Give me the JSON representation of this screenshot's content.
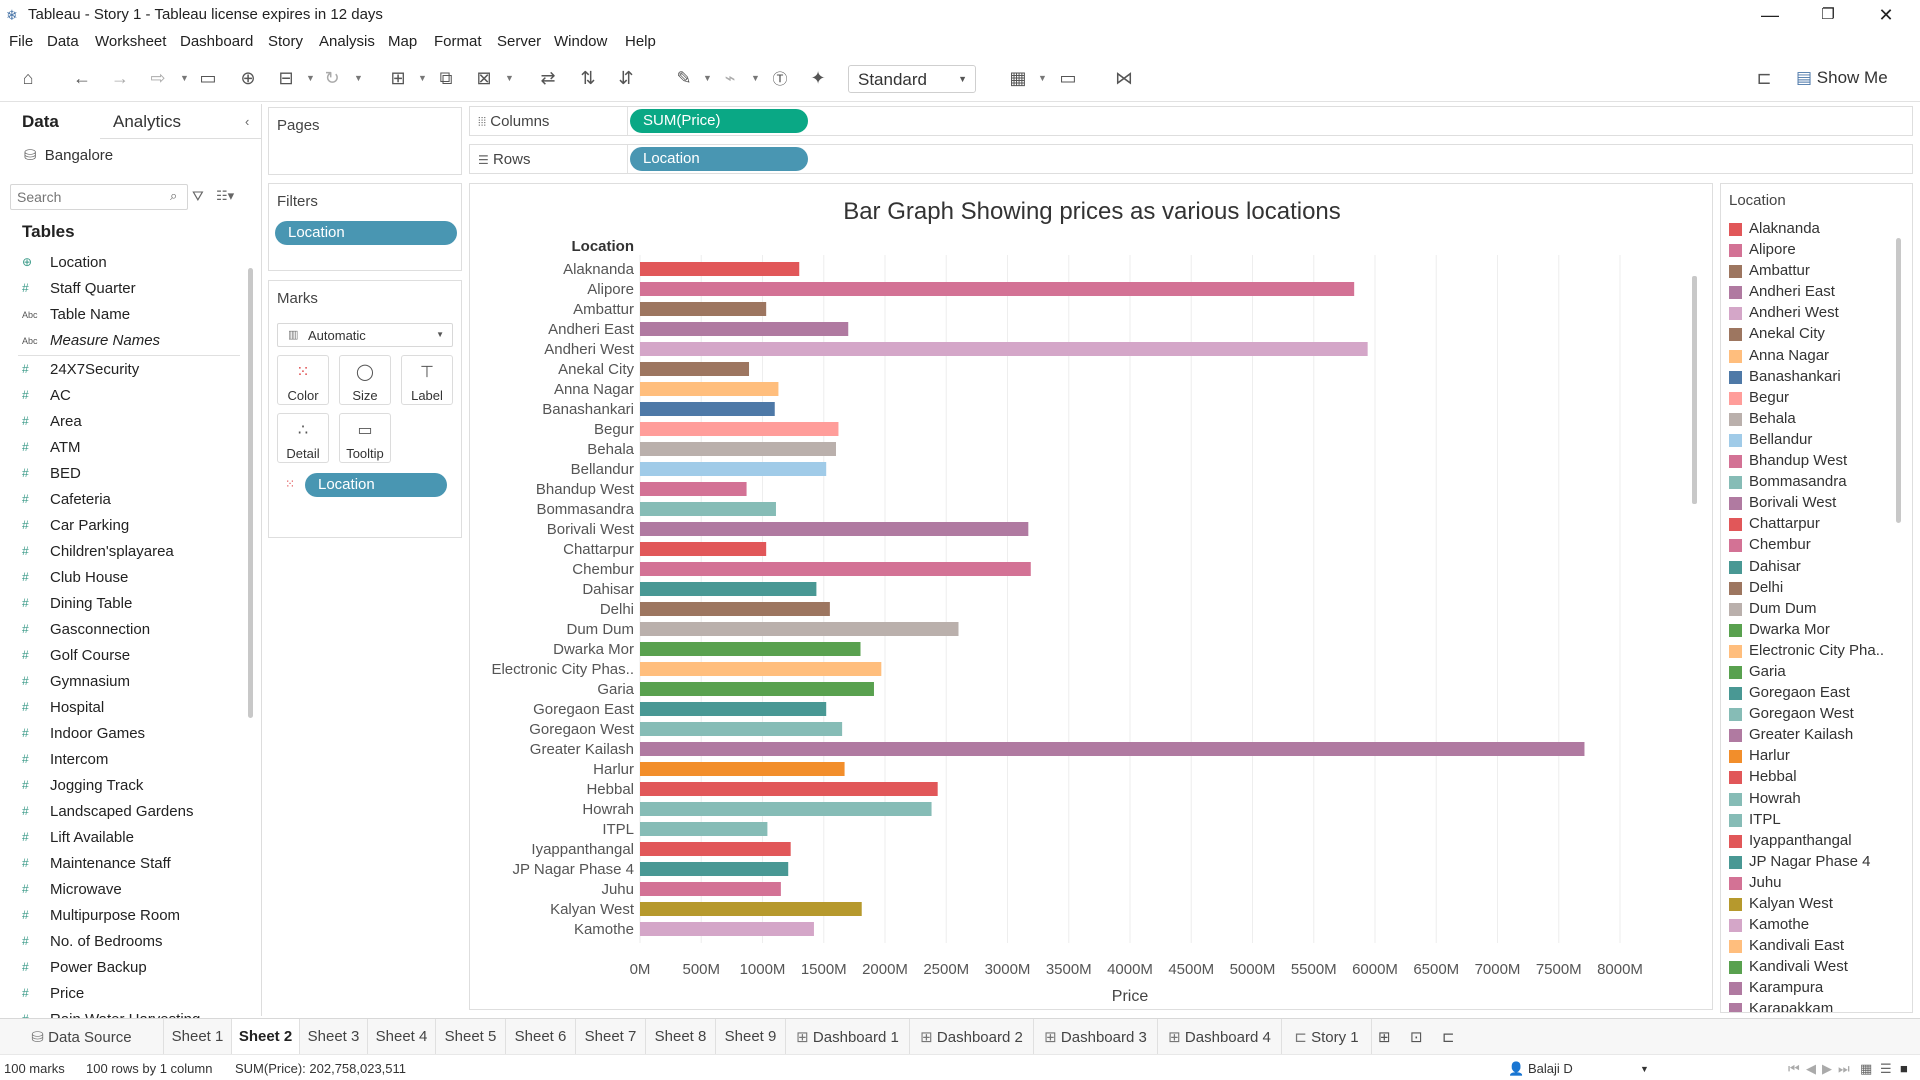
{
  "window": {
    "title": "Tableau - Story 1 - Tableau license expires in 12 days"
  },
  "menu": [
    "File",
    "Data",
    "Worksheet",
    "Dashboard",
    "Story",
    "Analysis",
    "Map",
    "Format",
    "Server",
    "Window",
    "Help"
  ],
  "toolbar": {
    "fit_value": "Standard",
    "show_me_label": "Show Me"
  },
  "data_pane": {
    "tab_data": "Data",
    "tab_analytics": "Analytics",
    "datasource": "Bangalore",
    "search_placeholder": "Search",
    "tables_heading": "Tables",
    "fields_top": [
      {
        "name": "Location",
        "type": "geo"
      },
      {
        "name": "Staff Quarter",
        "type": "num"
      },
      {
        "name": "Table Name",
        "type": "abc"
      },
      {
        "name": "Measure Names",
        "type": "abc",
        "italic": true
      }
    ],
    "fields_measures": [
      "24X7Security",
      "AC",
      "Area",
      "ATM",
      "BED",
      "Cafeteria",
      "Car Parking",
      "Children'splayarea",
      "Club House",
      "Dining Table",
      "Gasconnection",
      "Golf Course",
      "Gymnasium",
      "Hospital",
      "Indoor Games",
      "Intercom",
      "Jogging Track",
      "Landscaped Gardens",
      "Lift Available",
      "Maintenance Staff",
      "Microwave",
      "Multipurpose Room",
      "No. of Bedrooms",
      "Power Backup",
      "Price",
      "Rain Water Harvesting"
    ]
  },
  "shelves": {
    "pages_label": "Pages",
    "filters_label": "Filters",
    "filter_pill": "Location",
    "marks_label": "Marks",
    "mark_type": "Automatic",
    "mark_buttons": [
      "Color",
      "Size",
      "Label",
      "Detail",
      "Tooltip"
    ],
    "marks_pill": "Location",
    "columns_label": "Columns",
    "columns_pill": "SUM(Price)",
    "rows_label": "Rows",
    "rows_pill": "Location"
  },
  "chart_data": {
    "type": "bar",
    "orientation": "horizontal",
    "title": "Bar Graph Showing prices as various locations",
    "row_header": "Location",
    "xlabel": "Price",
    "xlim": [
      0,
      8000
    ],
    "x_unit": "M",
    "x_ticks": [
      "0M",
      "500M",
      "1000M",
      "1500M",
      "2000M",
      "2500M",
      "3000M",
      "3500M",
      "4000M",
      "4500M",
      "5000M",
      "5500M",
      "6000M",
      "6500M",
      "7000M",
      "7500M",
      "8000M"
    ],
    "grid": true,
    "categories": [
      "Alaknanda",
      "Alipore",
      "Ambattur",
      "Andheri East",
      "Andheri West",
      "Anekal City",
      "Anna Nagar",
      "Banashankari",
      "Begur",
      "Behala",
      "Bellandur",
      "Bhandup West",
      "Bommasandra",
      "Borivali West",
      "Chattarpur",
      "Chembur",
      "Dahisar",
      "Delhi",
      "Dum Dum",
      "Dwarka Mor",
      "Electronic City Phas..",
      "Garia",
      "Goregaon East",
      "Goregaon West",
      "Greater Kailash",
      "Harlur",
      "Hebbal",
      "Howrah",
      "ITPL",
      "Iyappanthangal",
      "JP Nagar Phase 4",
      "Juhu",
      "Kalyan West",
      "Kamothe"
    ],
    "values": [
      1300,
      5830,
      1030,
      1700,
      5940,
      890,
      1130,
      1100,
      1620,
      1600,
      1520,
      870,
      1110,
      3170,
      1030,
      3190,
      1440,
      1550,
      2600,
      1800,
      1970,
      1910,
      1520,
      1650,
      7710,
      1670,
      2430,
      2380,
      1040,
      1230,
      1210,
      1150,
      1810,
      1420
    ],
    "colors": [
      "#e15759",
      "#d37295",
      "#9d7660",
      "#b07aa1",
      "#d4a6c8",
      "#9d7660",
      "#ffbe7d",
      "#4e79a7",
      "#ff9d9a",
      "#bab0ac",
      "#a0cbe8",
      "#d37295",
      "#86bcb6",
      "#b07aa1",
      "#e15759",
      "#d37295",
      "#499894",
      "#9d7660",
      "#bab0ac",
      "#59a14f",
      "#ffbe7d",
      "#59a14f",
      "#499894",
      "#86bcb6",
      "#b07aa1",
      "#f28e2b",
      "#e15759",
      "#86bcb6",
      "#86bcb6",
      "#e15759",
      "#499894",
      "#d37295",
      "#b6992d",
      "#d4a6c8"
    ]
  },
  "legend": {
    "title": "Location",
    "items": [
      {
        "label": "Alaknanda",
        "color": "#e15759"
      },
      {
        "label": "Alipore",
        "color": "#d37295"
      },
      {
        "label": "Ambattur",
        "color": "#9d7660"
      },
      {
        "label": "Andheri East",
        "color": "#b07aa1"
      },
      {
        "label": "Andheri West",
        "color": "#d4a6c8"
      },
      {
        "label": "Anekal City",
        "color": "#9d7660"
      },
      {
        "label": "Anna Nagar",
        "color": "#ffbe7d"
      },
      {
        "label": "Banashankari",
        "color": "#4e79a7"
      },
      {
        "label": "Begur",
        "color": "#ff9d9a"
      },
      {
        "label": "Behala",
        "color": "#bab0ac"
      },
      {
        "label": "Bellandur",
        "color": "#a0cbe8"
      },
      {
        "label": "Bhandup West",
        "color": "#d37295"
      },
      {
        "label": "Bommasandra",
        "color": "#86bcb6"
      },
      {
        "label": "Borivali West",
        "color": "#b07aa1"
      },
      {
        "label": "Chattarpur",
        "color": "#e15759"
      },
      {
        "label": "Chembur",
        "color": "#d37295"
      },
      {
        "label": "Dahisar",
        "color": "#499894"
      },
      {
        "label": "Delhi",
        "color": "#9d7660"
      },
      {
        "label": "Dum Dum",
        "color": "#bab0ac"
      },
      {
        "label": "Dwarka Mor",
        "color": "#59a14f"
      },
      {
        "label": "Electronic City Pha..",
        "color": "#ffbe7d"
      },
      {
        "label": "Garia",
        "color": "#59a14f"
      },
      {
        "label": "Goregaon East",
        "color": "#499894"
      },
      {
        "label": "Goregaon West",
        "color": "#86bcb6"
      },
      {
        "label": "Greater Kailash",
        "color": "#b07aa1"
      },
      {
        "label": "Harlur",
        "color": "#f28e2b"
      },
      {
        "label": "Hebbal",
        "color": "#e15759"
      },
      {
        "label": "Howrah",
        "color": "#86bcb6"
      },
      {
        "label": "ITPL",
        "color": "#86bcb6"
      },
      {
        "label": "Iyappanthangal",
        "color": "#e15759"
      },
      {
        "label": "JP Nagar Phase 4",
        "color": "#499894"
      },
      {
        "label": "Juhu",
        "color": "#d37295"
      },
      {
        "label": "Kalyan West",
        "color": "#b6992d"
      },
      {
        "label": "Kamothe",
        "color": "#d4a6c8"
      },
      {
        "label": "Kandivali East",
        "color": "#ffbe7d"
      },
      {
        "label": "Kandivali West",
        "color": "#59a14f"
      },
      {
        "label": "Karampura",
        "color": "#b07aa1"
      },
      {
        "label": "Karapakkam",
        "color": "#b07aa1"
      }
    ]
  },
  "sheet_tabs": [
    {
      "label": "Data Source",
      "icon": "database-icon"
    },
    {
      "label": "Sheet 1"
    },
    {
      "label": "Sheet 2",
      "active": true
    },
    {
      "label": "Sheet 3"
    },
    {
      "label": "Sheet 4"
    },
    {
      "label": "Sheet 5"
    },
    {
      "label": "Sheet 6"
    },
    {
      "label": "Sheet 7"
    },
    {
      "label": "Sheet 8"
    },
    {
      "label": "Sheet 9"
    },
    {
      "label": "Dashboard 1",
      "icon": "dashboard-icon"
    },
    {
      "label": "Dashboard 2",
      "icon": "dashboard-icon"
    },
    {
      "label": "Dashboard 3",
      "icon": "dashboard-icon"
    },
    {
      "label": "Dashboard 4",
      "icon": "dashboard-icon"
    },
    {
      "label": "Story 1",
      "icon": "story-icon"
    }
  ],
  "status": {
    "marks": "100 marks",
    "dims": "100 rows by 1 column",
    "sum": "SUM(Price): 202,758,023,511",
    "user": "Balaji D"
  }
}
